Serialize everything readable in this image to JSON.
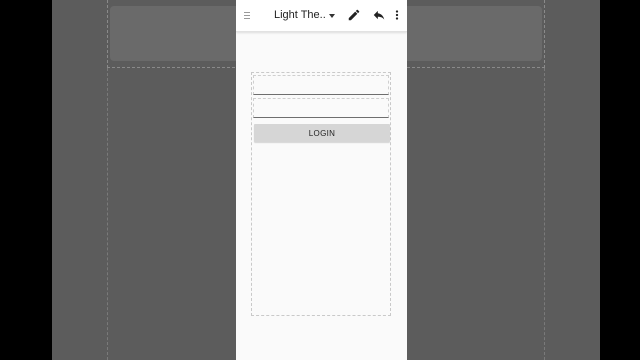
{
  "toolbar": {
    "theme_label": "Light The..",
    "icons": [
      "menu-icon",
      "chevron-down-icon",
      "pencil-icon",
      "undo-icon",
      "more-vertical-icon"
    ]
  },
  "form": {
    "username_value": "",
    "password_value": "",
    "login_label": "LOGIN"
  },
  "colors": {
    "panel_background": "#fafafa",
    "button_background": "#d6d6d6",
    "outer_background": "#000000"
  }
}
